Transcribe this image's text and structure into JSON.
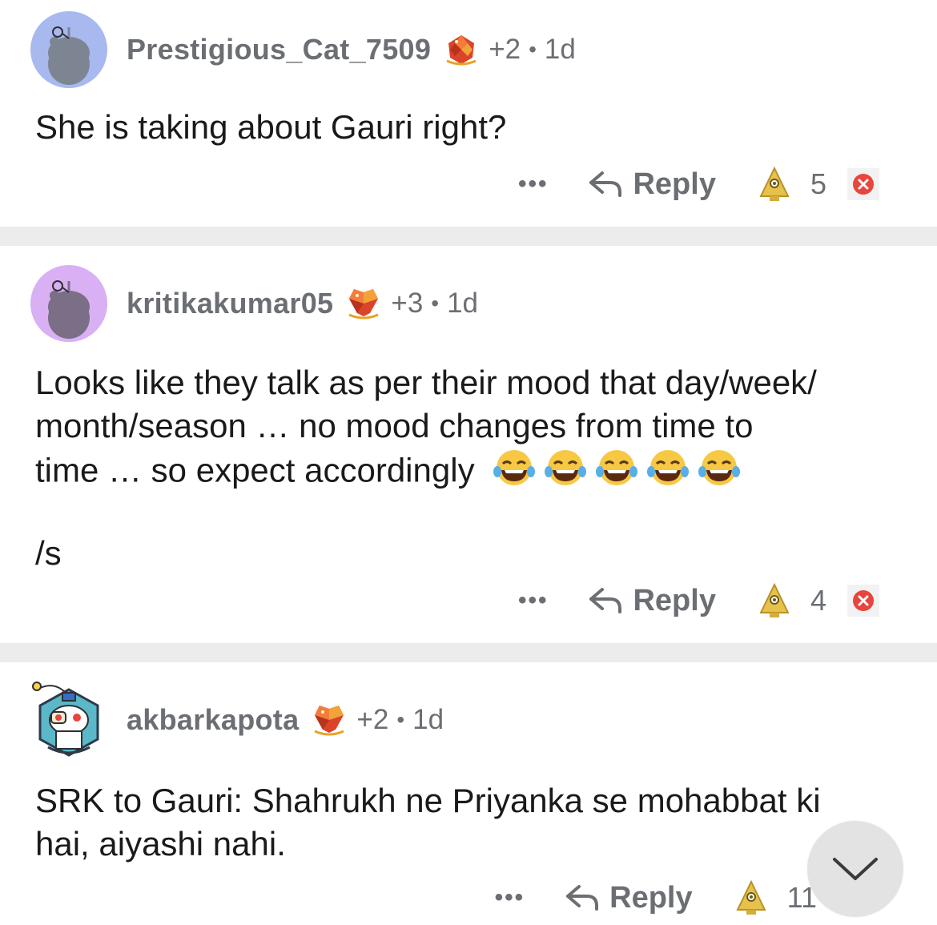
{
  "comments": [
    {
      "username": "Prestigious_Cat_7509",
      "karma": "+2",
      "separator": "•",
      "age": "1d",
      "body": "She is taking about Gauri right?",
      "more": "•••",
      "reply_label": "Reply",
      "score": "5",
      "avatar_color": "#a8b9f0"
    },
    {
      "username": "kritikakumar05",
      "karma": "+3",
      "separator": "•",
      "age": "1d",
      "body_lines": [
        "Looks like they talk as per their mood that day/week/",
        "month/season … no mood changes from time to",
        "time … so expect accordingly"
      ],
      "emojis": "😂😂😂😂😂",
      "body_tail": "/s",
      "more": "•••",
      "reply_label": "Reply",
      "score": "4",
      "avatar_color": "#d9b0f3"
    },
    {
      "username": "akbarkapota",
      "karma": "+2",
      "separator": "•",
      "age": "1d",
      "body_lines": [
        "SRK to Gauri: Shahrukh ne Priyanka se mohabbat ki",
        "hai, aiyashi nahi."
      ],
      "more": "•••",
      "reply_label": "Reply",
      "score": "11"
    }
  ],
  "icons": {
    "gem": "gem-award-icon",
    "reply": "reply-arrow-icon",
    "award": "gold-award-icon",
    "dismiss": "close-icon",
    "scroll": "chevron-down-icon"
  },
  "colors": {
    "muted_text": "#6b6e73",
    "body_text": "#1a1a1b",
    "divider": "#ececec",
    "dismiss_red": "#e8453c"
  }
}
